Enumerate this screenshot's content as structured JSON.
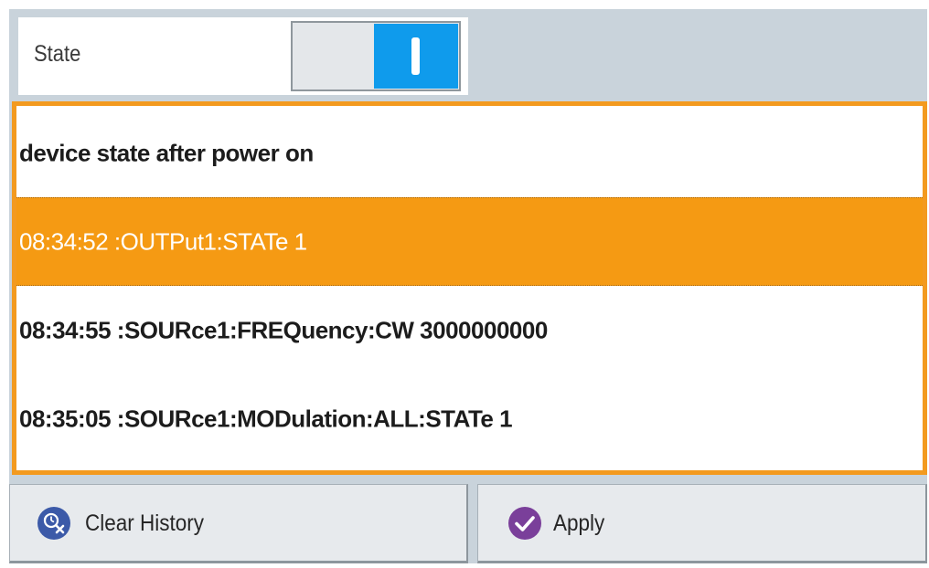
{
  "state": {
    "label": "State",
    "toggle_value": true
  },
  "history": {
    "rows": [
      {
        "text": "device state after power on",
        "selected": false
      },
      {
        "text": "08:34:52 :OUTPut1:STATe 1",
        "selected": true
      },
      {
        "text": "08:34:55 :SOURce1:FREQuency:CW 3000000000",
        "selected": false
      },
      {
        "text": "08:35:05 :SOURce1:MODulation:ALL:STATe 1",
        "selected": false
      }
    ]
  },
  "buttons": {
    "clear_label": "Clear History",
    "clear_icon": "clear-history-icon",
    "apply_label": "Apply",
    "apply_icon": "checkmark-icon"
  },
  "colors": {
    "accent_orange": "#f59a13",
    "toggle_blue": "#0f9bec",
    "background": "#c9d3db"
  }
}
